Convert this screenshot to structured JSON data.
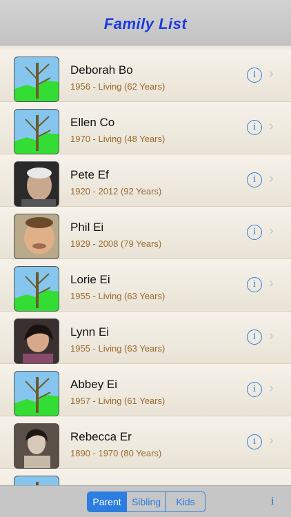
{
  "header": {
    "title": "Family List"
  },
  "people": [
    {
      "name": "Deborah Bo",
      "dates": "1956 - Living (62 Years)",
      "avatar": "tree-placeholder"
    },
    {
      "name": "Ellen Co",
      "dates": "1970 - Living (48 Years)",
      "avatar": "tree-placeholder"
    },
    {
      "name": "Pete Ef",
      "dates": "1920 - 2012 (92 Years)",
      "avatar": "photo"
    },
    {
      "name": "Phil Ei",
      "dates": "1929 - 2008 (79 Years)",
      "avatar": "photo"
    },
    {
      "name": "Lorie Ei",
      "dates": "1955 - Living (63 Years)",
      "avatar": "tree-placeholder"
    },
    {
      "name": "Lynn Ei",
      "dates": "1955 - Living (63 Years)",
      "avatar": "photo"
    },
    {
      "name": "Abbey Ei",
      "dates": "1957 - Living (61 Years)",
      "avatar": "tree-placeholder"
    },
    {
      "name": "Rebecca Er",
      "dates": "1890 - 1970 (80 Years)",
      "avatar": "photo"
    }
  ],
  "toolbar": {
    "segments": [
      {
        "label": "Parent",
        "selected": true
      },
      {
        "label": "Sibling",
        "selected": false
      },
      {
        "label": "Kids",
        "selected": false
      }
    ],
    "info_label": "i"
  },
  "colors": {
    "accent": "#2b7de0",
    "title": "#1a3be0",
    "dates": "#9a6a2c"
  }
}
